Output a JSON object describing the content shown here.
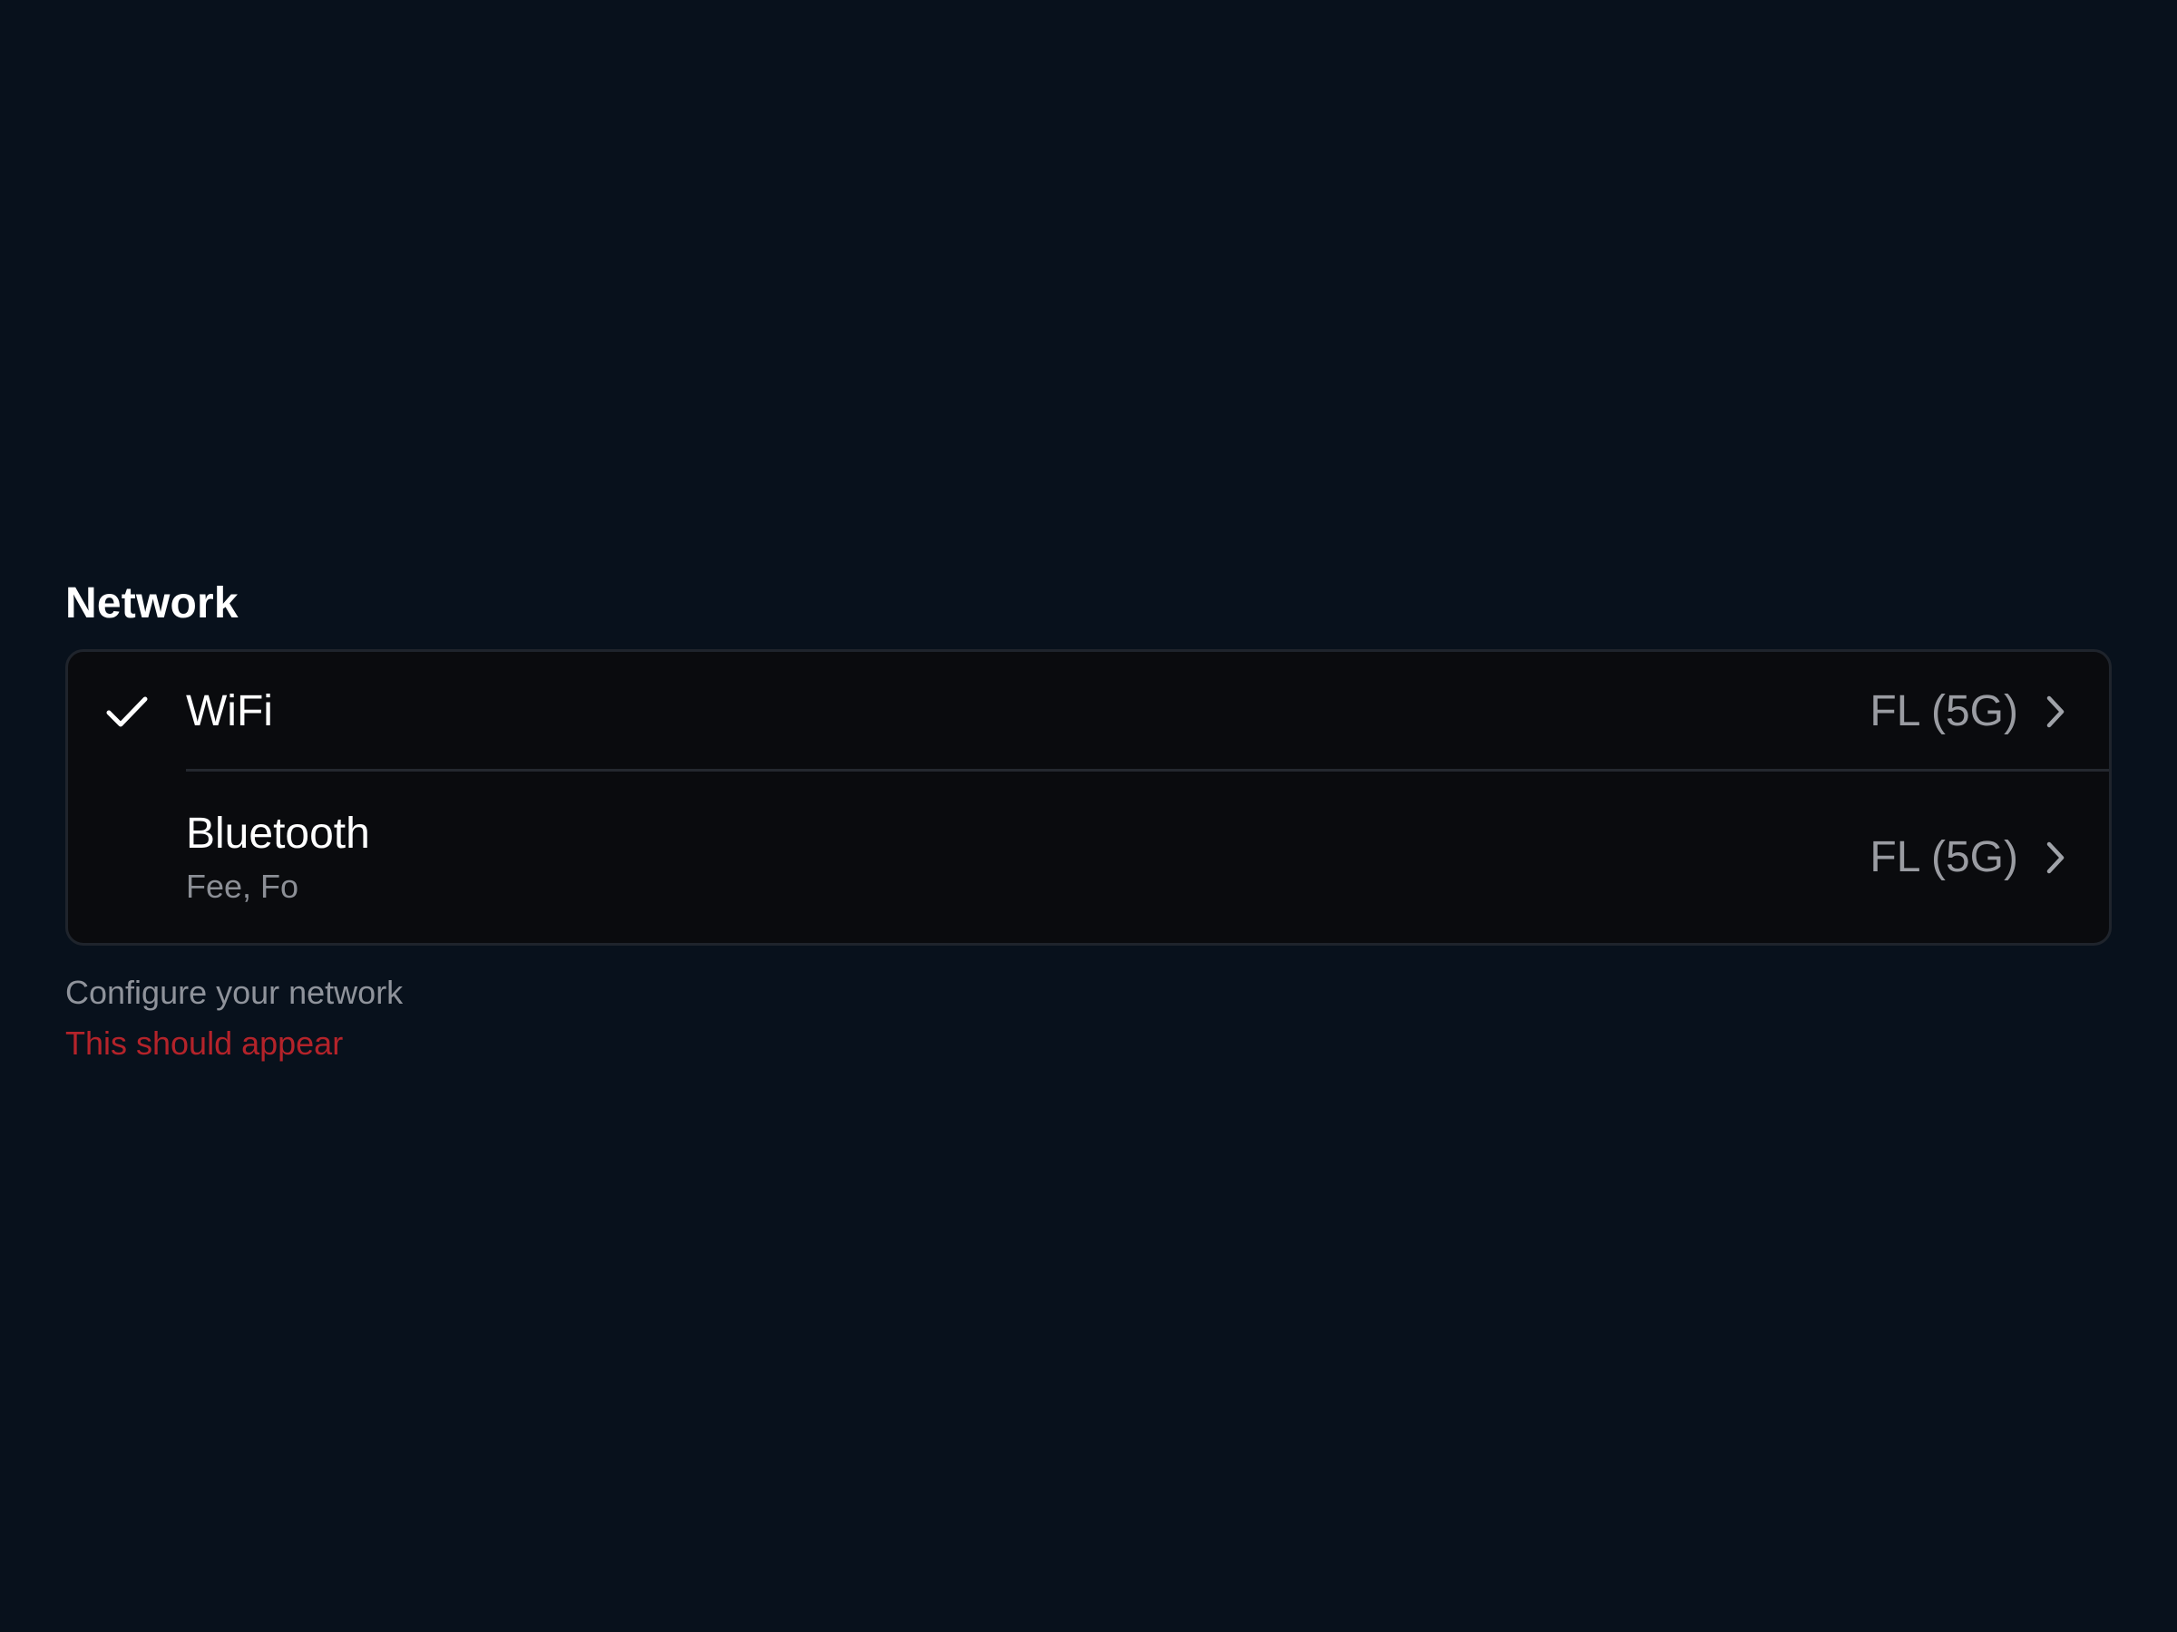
{
  "section": {
    "title": "Network",
    "helper_text": "Configure your network",
    "error_text": "This should appear"
  },
  "rows": [
    {
      "label": "WiFi",
      "value": "FL (5G)",
      "selected": true,
      "icon": "checkmark-icon",
      "trailing_icon": "chevron-right-icon"
    },
    {
      "label": "Bluetooth",
      "sublabel": "Fee, Fo",
      "value": "FL (5G)",
      "selected": false,
      "trailing_icon": "chevron-right-icon"
    }
  ],
  "colors": {
    "background": "#08111c",
    "card": "#0a0b0e",
    "border": "#1f242c",
    "text_primary": "#ffffff",
    "text_secondary": "#9a9ca2",
    "error": "#b4232a"
  }
}
